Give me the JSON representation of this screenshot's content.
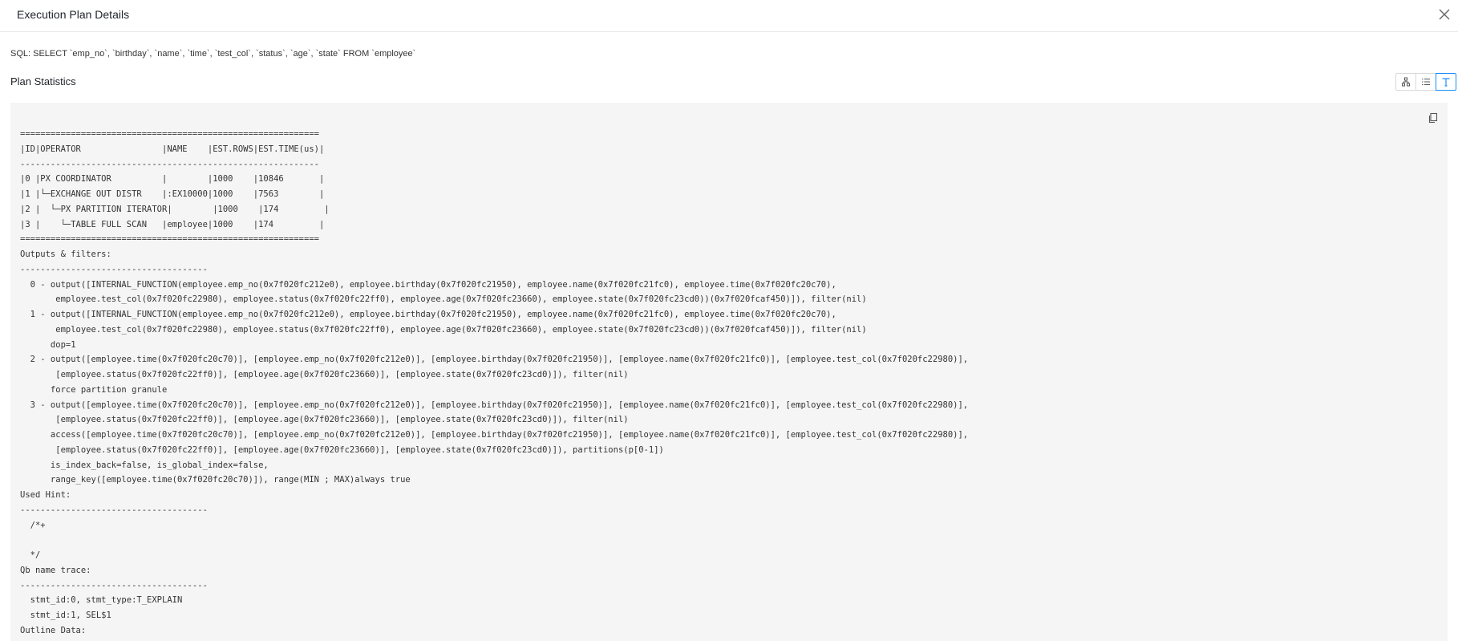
{
  "dialog": {
    "title": "Execution Plan Details"
  },
  "sql": {
    "text": "SQL: SELECT `emp_no`, `birthday`, `name`, `time`, `test_col`, `status`, `age`, `state` FROM `employee`"
  },
  "plan": {
    "section_title": "Plan Statistics",
    "view_buttons": [
      {
        "icon": "tree-view-icon",
        "active": false
      },
      {
        "icon": "list-view-icon",
        "active": false
      },
      {
        "icon": "text-view-icon",
        "active": true
      }
    ],
    "lines": [
      "===========================================================",
      "|ID|OPERATOR                |NAME    |EST.ROWS|EST.TIME(us)|",
      "-----------------------------------------------------------",
      "|0 |PX COORDINATOR          |        |1000    |10846       |",
      "|1 |└─EXCHANGE OUT DISTR    |:EX10000|1000    |7563        |",
      "|2 |  └─PX PARTITION ITERATOR|        |1000    |174         |",
      "|3 |    └─TABLE FULL SCAN   |employee|1000    |174         |",
      "===========================================================",
      "Outputs & filters:",
      "-------------------------------------",
      "  0 - output([INTERNAL_FUNCTION(employee.emp_no(0x7f020fc212e0), employee.birthday(0x7f020fc21950), employee.name(0x7f020fc21fc0), employee.time(0x7f020fc20c70),",
      "       employee.test_col(0x7f020fc22980), employee.status(0x7f020fc22ff0), employee.age(0x7f020fc23660), employee.state(0x7f020fc23cd0))(0x7f020fcaf450)]), filter(nil)",
      "  1 - output([INTERNAL_FUNCTION(employee.emp_no(0x7f020fc212e0), employee.birthday(0x7f020fc21950), employee.name(0x7f020fc21fc0), employee.time(0x7f020fc20c70),",
      "       employee.test_col(0x7f020fc22980), employee.status(0x7f020fc22ff0), employee.age(0x7f020fc23660), employee.state(0x7f020fc23cd0))(0x7f020fcaf450)]), filter(nil)",
      "      dop=1",
      "  2 - output([employee.time(0x7f020fc20c70)], [employee.emp_no(0x7f020fc212e0)], [employee.birthday(0x7f020fc21950)], [employee.name(0x7f020fc21fc0)], [employee.test_col(0x7f020fc22980)],",
      "       [employee.status(0x7f020fc22ff0)], [employee.age(0x7f020fc23660)], [employee.state(0x7f020fc23cd0)]), filter(nil)",
      "      force partition granule",
      "  3 - output([employee.time(0x7f020fc20c70)], [employee.emp_no(0x7f020fc212e0)], [employee.birthday(0x7f020fc21950)], [employee.name(0x7f020fc21fc0)], [employee.test_col(0x7f020fc22980)],",
      "       [employee.status(0x7f020fc22ff0)], [employee.age(0x7f020fc23660)], [employee.state(0x7f020fc23cd0)]), filter(nil)",
      "      access([employee.time(0x7f020fc20c70)], [employee.emp_no(0x7f020fc212e0)], [employee.birthday(0x7f020fc21950)], [employee.name(0x7f020fc21fc0)], [employee.test_col(0x7f020fc22980)],",
      "       [employee.status(0x7f020fc22ff0)], [employee.age(0x7f020fc23660)], [employee.state(0x7f020fc23cd0)]), partitions(p[0-1])",
      "      is_index_back=false, is_global_index=false,",
      "      range_key([employee.time(0x7f020fc20c70)]), range(MIN ; MAX)always true",
      "Used Hint:",
      "-------------------------------------",
      "  /*+",
      "",
      "  */",
      "Qb name trace:",
      "-------------------------------------",
      "  stmt_id:0, stmt_type:T_EXPLAIN",
      "  stmt_id:1, SEL$1",
      "Outline Data:"
    ]
  },
  "colors": {
    "accent": "#1890ff",
    "panel_bg": "#f5f5f5",
    "text": "#333333"
  }
}
